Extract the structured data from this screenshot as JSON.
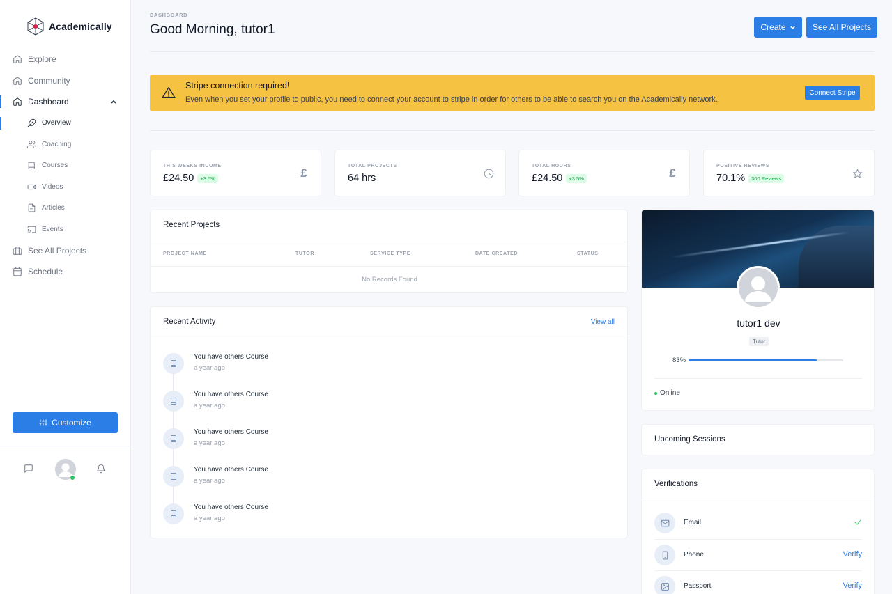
{
  "app": {
    "name": "Academically"
  },
  "sidebar": {
    "items": [
      {
        "label": "Explore",
        "icon": "home-icon"
      },
      {
        "label": "Community",
        "icon": "home-icon"
      },
      {
        "label": "Dashboard",
        "icon": "home-icon"
      }
    ],
    "sub_items": [
      {
        "label": "Overview",
        "icon": "feather-icon"
      },
      {
        "label": "Coaching",
        "icon": "users-icon"
      },
      {
        "label": "Courses",
        "icon": "book-icon"
      },
      {
        "label": "Videos",
        "icon": "video-icon"
      },
      {
        "label": "Articles",
        "icon": "file-text-icon"
      },
      {
        "label": "Events",
        "icon": "cast-icon"
      }
    ],
    "bottom_items": [
      {
        "label": "See All Projects",
        "icon": "briefcase-icon"
      },
      {
        "label": "Schedule",
        "icon": "calendar-icon"
      }
    ],
    "customize_label": "Customize"
  },
  "header": {
    "breadcrumb": "DASHBOARD",
    "title": "Good Morning, tutor1",
    "create_label": "Create",
    "see_all_label": "See All Projects"
  },
  "alert": {
    "title": "Stripe connection required!",
    "text": "Even when you set your profile to public, you need to connect your account to stripe in order for others to be able to search you on the Academically network.",
    "button": "Connect Stripe",
    "color": "#f5c242"
  },
  "stats": [
    {
      "label": "THIS WEEKS INCOME",
      "value": "£24.50",
      "badge": "+3.5%",
      "icon": "£"
    },
    {
      "label": "TOTAL PROJECTS",
      "value": "64 hrs",
      "badge": "",
      "icon": "clock-icon"
    },
    {
      "label": "TOTAL HOURS",
      "value": "£24.50",
      "badge": "+3.5%",
      "icon": "£"
    },
    {
      "label": "POSITIVE REVIEWS",
      "value": "70.1%",
      "badge": "300 Reviews",
      "icon": "star-icon"
    }
  ],
  "recent_projects": {
    "title": "Recent Projects",
    "columns": [
      "PROJECT NAME",
      "TUTOR",
      "SERVICE TYPE",
      "DATE CREATED",
      "STATUS"
    ],
    "empty": "No Records Found"
  },
  "recent_activity": {
    "title": "Recent Activity",
    "view_all": "View all",
    "items": [
      {
        "title": "You have others Course",
        "time": "a year ago"
      },
      {
        "title": "You have others Course",
        "time": "a year ago"
      },
      {
        "title": "You have others Course",
        "time": "a year ago"
      },
      {
        "title": "You have others Course",
        "time": "a year ago"
      },
      {
        "title": "You have others Course",
        "time": "a year ago"
      }
    ]
  },
  "profile": {
    "name": "tutor1 dev",
    "role": "Tutor",
    "progress_label": "83%",
    "progress": 0.83,
    "status": "Online"
  },
  "upcoming_sessions": {
    "title": "Upcoming Sessions"
  },
  "verifications": {
    "title": "Verifications",
    "items": [
      {
        "label": "Email",
        "status": "verified",
        "action": ""
      },
      {
        "label": "Phone",
        "status": "unverified",
        "action": "Verify"
      },
      {
        "label": "Passport",
        "status": "unverified",
        "action": "Verify"
      }
    ]
  },
  "colors": {
    "accent": "#2b7ee6",
    "success": "#22c55e",
    "warning": "#f5c242"
  }
}
